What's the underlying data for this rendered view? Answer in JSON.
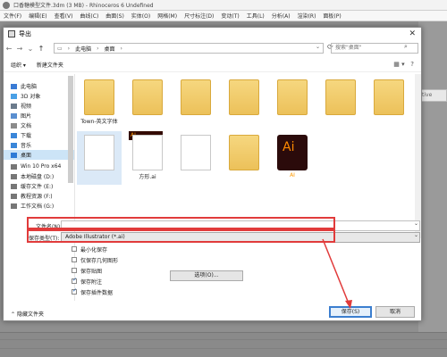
{
  "app": {
    "title": "口香糖模型文件.3dm (3 MB) - Rhinoceros 6 Undefined",
    "menu": [
      "文件(F)",
      "编辑(E)",
      "查看(V)",
      "曲线(C)",
      "曲面(S)",
      "实体(O)",
      "网格(M)",
      "尺寸标注(D)",
      "变动(T)",
      "工具(L)",
      "分析(A)",
      "渲染(R)",
      "面板(P)"
    ],
    "right_toolbar_text": "tive"
  },
  "dialog": {
    "title": "导出",
    "breadcrumb": [
      "此电脑",
      "桌面"
    ],
    "search_placeholder": "搜索\"桌面\"",
    "toolbar": {
      "organize": "组织 ▾",
      "new_folder": "新建文件夹"
    },
    "sidebar": [
      {
        "label": "此电脑",
        "icon": "computer-icon",
        "selected": false
      },
      {
        "label": "3D 对象",
        "icon": "cube-icon",
        "selected": false
      },
      {
        "label": "视频",
        "icon": "video-icon",
        "selected": false
      },
      {
        "label": "图片",
        "icon": "picture-icon",
        "selected": false
      },
      {
        "label": "文档",
        "icon": "document-icon",
        "selected": false
      },
      {
        "label": "下载",
        "icon": "download-icon",
        "selected": false
      },
      {
        "label": "音乐",
        "icon": "music-icon",
        "selected": false
      },
      {
        "label": "桌面",
        "icon": "desktop-icon",
        "selected": true
      },
      {
        "label": "Win 10 Pro x64",
        "icon": "drive-icon",
        "selected": false
      },
      {
        "label": "本地磁盘 (D:)",
        "icon": "drive-icon",
        "selected": false
      },
      {
        "label": "缓存文件 (E:)",
        "icon": "drive-icon",
        "selected": false
      },
      {
        "label": "教程资源 (F:)",
        "icon": "drive-icon",
        "selected": false
      },
      {
        "label": "工作文档 (G:)",
        "icon": "drive-icon",
        "selected": false
      }
    ],
    "files": [
      {
        "label": "Town-英文字体",
        "kind": "folder"
      },
      {
        "label": "",
        "kind": "folder"
      },
      {
        "label": "",
        "kind": "folder"
      },
      {
        "label": "",
        "kind": "folder"
      },
      {
        "label": "",
        "kind": "folder"
      },
      {
        "label": "",
        "kind": "folder"
      },
      {
        "label": "",
        "kind": "folder"
      },
      {
        "label": "",
        "kind": "document"
      },
      {
        "label": "方形.ai",
        "kind": "ai-file"
      },
      {
        "label": "",
        "kind": "document"
      },
      {
        "label": "",
        "kind": "folder"
      },
      {
        "label": "AI",
        "kind": "ai-app"
      }
    ],
    "ai_badge": "AI",
    "ai_text": "Ai",
    "filename_label": "文件名(N):",
    "filename_value": "",
    "savetype_label": "保存类型(T):",
    "savetype_value": "Adobe Illustrator (*.ai)",
    "options_button": "选项(O)...",
    "checkboxes": [
      {
        "label": "最小化保存",
        "checked": false
      },
      {
        "label": "仅保存几何图形",
        "checked": false
      },
      {
        "label": "保存贴图",
        "checked": false
      },
      {
        "label": "保存附注",
        "checked": true
      },
      {
        "label": "保存插件数据",
        "checked": true
      }
    ],
    "hide_folders": "隐藏文件夹",
    "save_button": "保存(S)",
    "cancel_button": "取消"
  },
  "colors": {
    "highlight": "#e13b3b",
    "selection": "#cce4f7",
    "primary_button": "#3b7ecf"
  }
}
